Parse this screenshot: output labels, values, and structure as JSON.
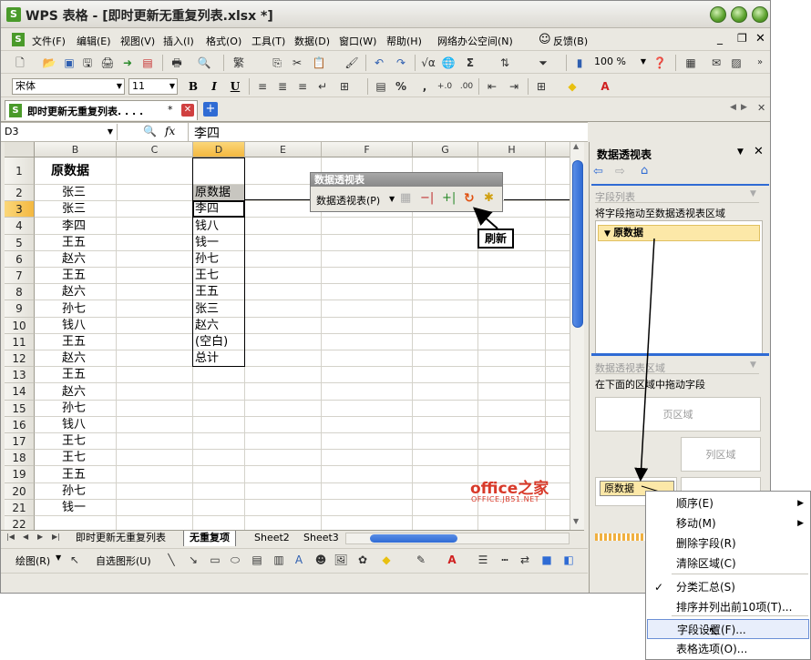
{
  "window": {
    "app_name": "WPS 表格",
    "doc_title": " - [即时更新无重复列表.xlsx *]"
  },
  "menu": {
    "items": [
      "文件(F)",
      "编辑(E)",
      "视图(V)",
      "插入(I)",
      "格式(O)",
      "工具(T)",
      "数据(D)",
      "窗口(W)",
      "帮助(H)",
      "网络办公空间(N)",
      "反馈(B)"
    ]
  },
  "toolbar": {
    "zoom": "100 %",
    "sigma": "Σ"
  },
  "format_bar": {
    "font_name": "宋体",
    "font_size": "11",
    "bold": "B",
    "italic": "I",
    "underline": "U",
    "percent": "%",
    "comma": ","
  },
  "doc_tab": {
    "label": "即时更新无重复列表. . . .",
    "modified": "*"
  },
  "formula_bar": {
    "name_box": "D3",
    "fx": "fx",
    "value": "李四"
  },
  "columns": [
    "B",
    "C",
    "D",
    "E",
    "F",
    "G",
    "H"
  ],
  "rows": [
    "1",
    "2",
    "3",
    "4",
    "5",
    "6",
    "7",
    "8",
    "9",
    "10",
    "11",
    "12",
    "13",
    "14",
    "15",
    "16",
    "17",
    "18",
    "19",
    "20",
    "21",
    "22"
  ],
  "col_b": [
    "原数据",
    "张三",
    "张三",
    "李四",
    "王五",
    "赵六",
    "王五",
    "赵六",
    "孙七",
    "钱八",
    "王五",
    "赵六",
    "王五",
    "赵六",
    "孙七",
    "钱八",
    "王七",
    "王七",
    "王五",
    "孙七",
    "钱一",
    ""
  ],
  "col_d": [
    "",
    "原数据",
    "李四",
    "钱八",
    "钱一",
    "孙七",
    "王七",
    "王五",
    "张三",
    "赵六",
    "(空白)",
    "总计"
  ],
  "pivot_toolbar": {
    "title": "数据透视表",
    "menu_label": "数据透视表(P)"
  },
  "callout": {
    "label": "刷新"
  },
  "watermark": {
    "main": "office之家",
    "sub": "OFFICE.JB51.NET"
  },
  "sheet_tabs": [
    "即时更新无重复列表",
    "无重复项",
    "Sheet2",
    "Sheet3"
  ],
  "draw_bar": {
    "draw_label": "绘图(R)",
    "autoshape_label": "自选图形(U)"
  },
  "panel": {
    "title": "数据透视表",
    "field_list_header": "字段列表",
    "field_list_hint": "将字段拖动至数据透视表区域",
    "field_item": "原数据",
    "area_header": "数据透视表区域",
    "area_hint": "在下面的区域中拖动字段",
    "page_area": "页区域",
    "col_area": "列区域",
    "data_field_chip": "原数据"
  },
  "context_menu": {
    "items": [
      {
        "label": "顺序(E)",
        "submenu": true,
        "checked": false
      },
      {
        "label": "移动(M)",
        "submenu": true,
        "checked": false
      },
      {
        "label": "删除字段(R)",
        "submenu": false,
        "checked": false
      },
      {
        "label": "清除区域(C)",
        "submenu": false,
        "checked": false
      },
      {
        "label": "分类汇总(S)",
        "submenu": false,
        "checked": true
      },
      {
        "label": "排序并列出前10项(T)...",
        "submenu": false,
        "checked": false
      },
      {
        "label": "字段设置(F)...",
        "submenu": false,
        "checked": false,
        "highlighted": true
      },
      {
        "label": "表格选项(O)...",
        "submenu": false,
        "checked": false
      }
    ]
  },
  "colors": {
    "accent": "#2f6bd4",
    "highlight_row": "#fce8a8",
    "watermark_red": "#d83a2a"
  }
}
